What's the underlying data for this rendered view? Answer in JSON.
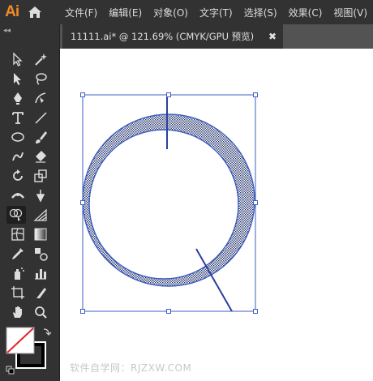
{
  "app": {
    "logo_text": "Ai"
  },
  "menu": [
    {
      "label": "文件(F)"
    },
    {
      "label": "编辑(E)"
    },
    {
      "label": "对象(O)"
    },
    {
      "label": "文字(T)"
    },
    {
      "label": "选择(S)"
    },
    {
      "label": "效果(C)"
    },
    {
      "label": "视图(V)"
    }
  ],
  "toolbar": {
    "collapse_label": "◂◂"
  },
  "document_tab": {
    "title": "11111.ai* @ 121.69% (CMYK/GPU 预览)",
    "close_label": "✖"
  },
  "watermark": "软件自学网：RJZXW.COM",
  "colors": {
    "accent": "#f28a24",
    "selection": "#3b5ec7",
    "stroke_swatch": "#000000",
    "none_slash": "#e0262a"
  },
  "tools": [
    "selection-tool",
    "direct-selection-tool",
    "magic-wand-tool",
    "lasso-tool",
    "pen-tool",
    "curvature-tool",
    "type-tool",
    "line-segment-tool",
    "ellipse-tool",
    "paintbrush-tool",
    "shaper-tool",
    "eraser-tool",
    "rotate-tool",
    "scale-tool",
    "width-tool",
    "puppet-warp-tool",
    "shape-builder-tool",
    "perspective-grid-tool",
    "mesh-tool",
    "gradient-tool",
    "eyedropper-tool",
    "blend-tool",
    "symbol-sprayer-tool",
    "column-graph-tool",
    "artboard-tool",
    "slice-tool",
    "hand-tool",
    "zoom-tool"
  ]
}
